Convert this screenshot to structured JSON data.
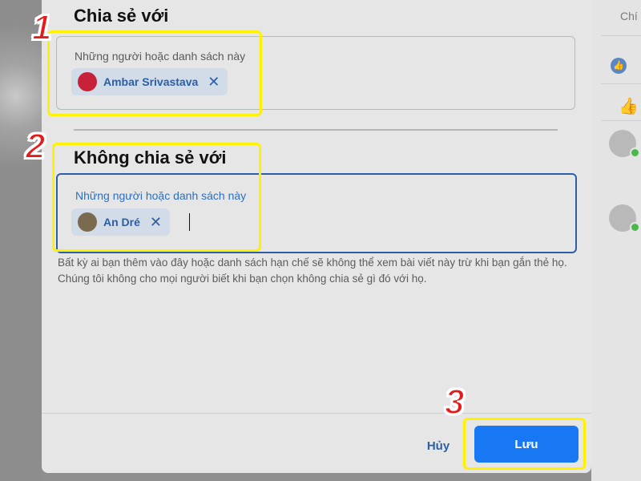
{
  "dialog": {
    "share_with": {
      "heading": "Chia sẻ với",
      "field_label": "Những người hoặc danh sách này",
      "chips": [
        {
          "name": "Ambar Srivastava",
          "avatar_color": "#c8213a"
        }
      ]
    },
    "not_share_with": {
      "heading": "Không chia sẻ với",
      "field_label": "Những người hoặc danh sách này",
      "chips": [
        {
          "name": "An Dré",
          "avatar_color": "#7a6b4e"
        }
      ]
    },
    "note": "Bất kỳ ai bạn thêm vào đây hoặc danh sách hạn chế sẽ không thể xem bài viết này trừ khi bạn gắn thẻ họ. Chúng tôi không cho mọi người biết khi bạn chọn không chia sẻ gì đó với họ.",
    "cancel_label": "Hủy",
    "save_label": "Lưu"
  },
  "background": {
    "right_panel_text": "Chí"
  },
  "annotations": {
    "step1": "1",
    "step2": "2",
    "step3": "3",
    "highlight_color": "#fff200",
    "number_color": "#e31b1b"
  },
  "icons": {
    "remove": "close-icon"
  },
  "colors": {
    "accent": "#1877f2",
    "chip_text": "#2a5fa6"
  }
}
